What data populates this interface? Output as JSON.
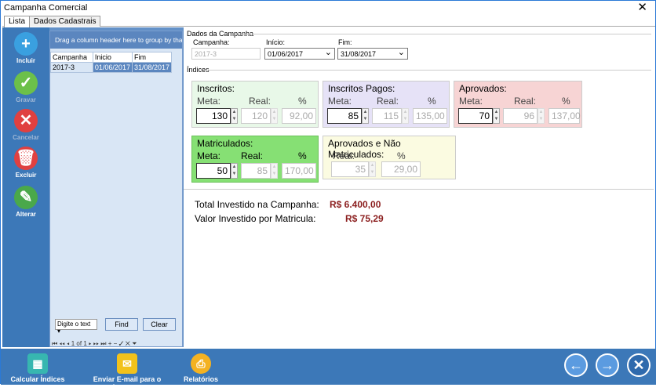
{
  "window": {
    "title": "Campanha Comercial",
    "close": "✕"
  },
  "tabs": [
    "Lista",
    "Dados Cadastrais"
  ],
  "side": {
    "incluir": "Incluir",
    "gravar": "Gravar",
    "cancelar": "Cancelar",
    "excluir": "Excluir",
    "alterar": "Alterar"
  },
  "grid": {
    "group_hint": "Drag a column header here to group by that c",
    "headers": [
      "Campanha",
      "Inicio",
      "Fim"
    ],
    "rows": [
      [
        "2017-3",
        "01/06/2017",
        "31/08/2017"
      ]
    ],
    "search_placeholder": "Digite o text",
    "find": "Find",
    "clear": "Clear",
    "pager": "1 of 1"
  },
  "dados": {
    "group": "Dados da Campanha",
    "campanha_label": "Campanha:",
    "campanha_value": "2017-3",
    "inicio_label": "Início:",
    "inicio_value": "01/06/2017",
    "fim_label": "Fim:",
    "fim_value": "31/08/2017"
  },
  "indices": {
    "group": "Índices",
    "meta": "Meta:",
    "real": "Real:",
    "pct": "%",
    "inscritos": {
      "title": "Inscritos:",
      "meta": "130",
      "real": "120",
      "pct": "92,00"
    },
    "pagos": {
      "title": "Inscritos Pagos:",
      "meta": "85",
      "real": "115",
      "pct": "135,00"
    },
    "aprovados": {
      "title": "Aprovados:",
      "meta": "70",
      "real": "96",
      "pct": "137,00"
    },
    "matriculados": {
      "title": "Matriculados:",
      "meta": "50",
      "real": "85",
      "pct": "170,00"
    },
    "naomat": {
      "title": "Aprovados e Não Matriculados:",
      "real": "35",
      "pct": "29,00"
    }
  },
  "totals": {
    "invest_label": "Total Investido na Campanha:",
    "invest_value": "R$ 6.400,00",
    "por_label": "Valor Investido por Matricula:",
    "por_value": "R$ 75,29"
  },
  "bottom": {
    "calc": "Calcular Índices",
    "email": "Enviar E-mail para o Assessor",
    "rel": "Relatórios"
  },
  "colors": {
    "green": "#e8f8e8",
    "purple": "#e6e2f7",
    "red": "#f7d4d4",
    "bright": "#86e074",
    "yellow": "#fbfbe1",
    "accent": "#3c78b8"
  }
}
